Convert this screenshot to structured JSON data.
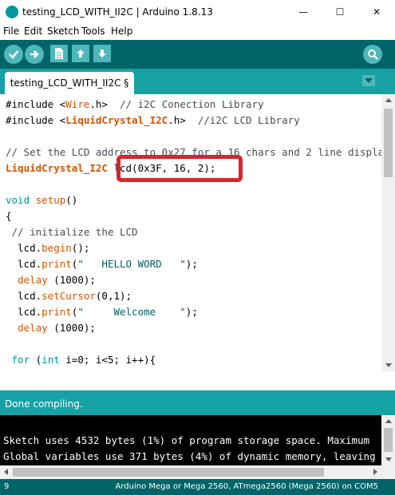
{
  "window": {
    "title": "testing_LCD_WITH_II2C | Arduino 1.8.13",
    "minimize": "—",
    "maximize": "☐",
    "close": "✕"
  },
  "menu": {
    "items": [
      "File",
      "Edit",
      "Sketch",
      "Tools",
      "Help"
    ]
  },
  "toolbar": {
    "verify_icon": "check-icon",
    "upload_icon": "arrow-right-icon",
    "new_icon": "document-icon",
    "open_icon": "arrow-up-icon",
    "save_icon": "arrow-down-icon",
    "serial_monitor_icon": "magnifier-icon"
  },
  "tabs": {
    "active": "testing_LCD_WITH_II2C §"
  },
  "status": {
    "message": "Done compiling."
  },
  "console": {
    "lines": [
      "Sketch uses 4532 bytes (1%) of program storage space. Maximum",
      "Global variables use 371 bytes (4%) of dynamic memory, leaving"
    ]
  },
  "footer": {
    "line_number": "9",
    "board": "Arduino Mega or Mega 2560, ATmega2560 (Mega 2560) on COM5"
  },
  "colors": {
    "toolbar": "#006468",
    "tabstrip": "#17a1a5",
    "button": "#4db7bb",
    "highlight": "#d7262b"
  }
}
